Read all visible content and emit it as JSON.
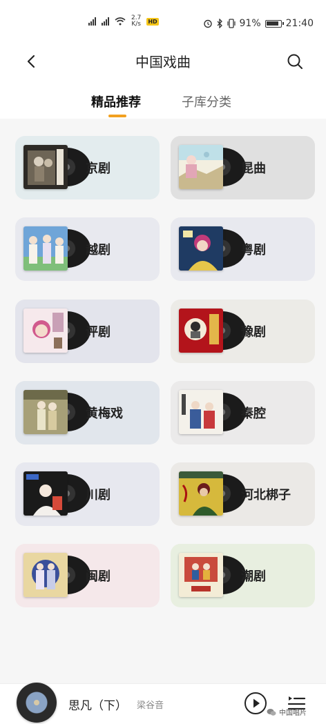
{
  "status_bar": {
    "network_speed_value": "2.7",
    "network_speed_unit": "K/s",
    "hd_badge": "HD",
    "battery": "91%",
    "time": "21:40"
  },
  "header": {
    "title": "中国戏曲",
    "back_icon": "chevron-left-icon",
    "search_icon": "search-icon"
  },
  "tabs": [
    {
      "label": "精品推荐",
      "active": true
    },
    {
      "label": "子库分类",
      "active": false
    }
  ],
  "colors": {
    "accent": "#f2a01f",
    "page_bg": "#f6f6f6"
  },
  "categories": [
    {
      "name": "京剧",
      "bg": "#e3ecee"
    },
    {
      "name": "昆曲",
      "bg": "#e0e0e0"
    },
    {
      "name": "越剧",
      "bg": "#e8e9ef"
    },
    {
      "name": "粤剧",
      "bg": "#e8e9ef"
    },
    {
      "name": "评剧",
      "bg": "#e3e4ec"
    },
    {
      "name": "豫剧",
      "bg": "#ecebe7"
    },
    {
      "name": "黄梅戏",
      "bg": "#e1e6ec"
    },
    {
      "name": "秦腔",
      "bg": "#ebeaea"
    },
    {
      "name": "川剧",
      "bg": "#e7e8ef"
    },
    {
      "name": "河北梆子",
      "bg": "#ebe9e6"
    },
    {
      "name": "闽剧",
      "bg": "#f5e8ea"
    },
    {
      "name": "潮剧",
      "bg": "#e8efe0"
    }
  ],
  "player": {
    "song": "思凡（下）",
    "artist": "梁谷音",
    "play_icon": "play-icon",
    "playlist_icon": "playlist-icon"
  },
  "watermark": "中国唱片"
}
